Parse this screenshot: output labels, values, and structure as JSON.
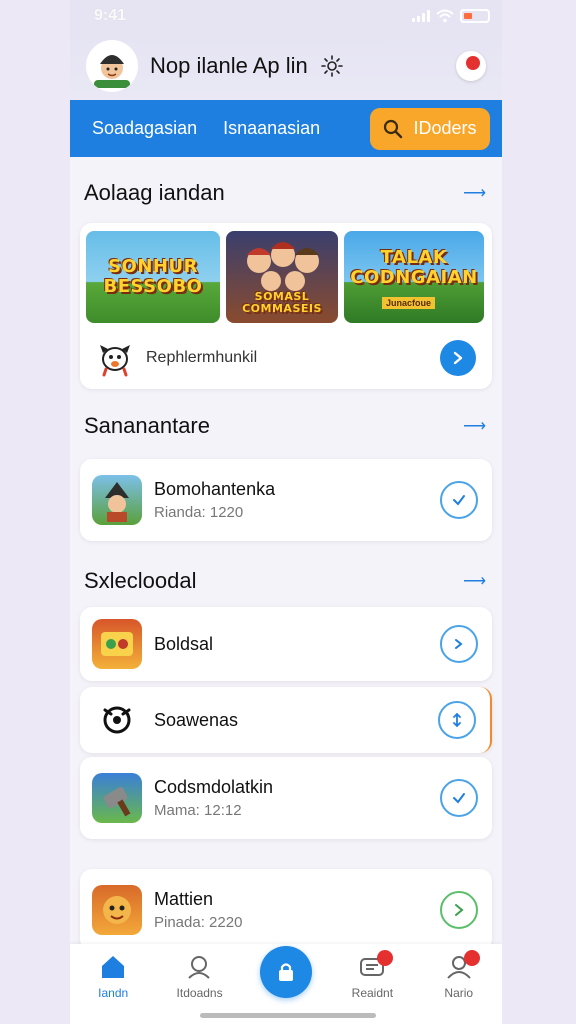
{
  "status_bar": {
    "time": "9:41"
  },
  "header": {
    "title": "Nop ilanle Ap lin"
  },
  "nav": {
    "tabs": [
      "Soadagasian",
      "Isnaanasian"
    ],
    "search_label": "IDoders"
  },
  "featured": {
    "title": "Aolaag iandan",
    "more": "⟶",
    "banners": [
      {
        "text": "SONHUR BESSOBO"
      },
      {
        "text": "SOMASL COMMASEIS"
      },
      {
        "text": "TALAK CODNGAIAN",
        "sub": "Junacfoue"
      }
    ],
    "row_label": "Rephlermhunkil"
  },
  "section2": {
    "title": "Sananantare",
    "more": "⟶",
    "items": [
      {
        "name": "Bomohantenka",
        "sub": "Rianda: 1220"
      }
    ]
  },
  "section3": {
    "title": "Sxlecloodal",
    "more": "⟶",
    "items": [
      {
        "name": "Boldsal",
        "sub": ""
      },
      {
        "name": "Soawenas",
        "sub": ""
      },
      {
        "name": "Codsmdolatkin",
        "sub": "Mama: 12:12"
      },
      {
        "name": "Mattien",
        "sub": "Pinada: 2220"
      }
    ]
  },
  "bottom_nav": {
    "tabs": [
      {
        "label": "Iandn"
      },
      {
        "label": "Itdoadns"
      },
      {
        "label": ""
      },
      {
        "label": "Reaidnt"
      },
      {
        "label": "Nario"
      }
    ]
  },
  "colors": {
    "primary": "#1e7fe0",
    "accent": "#f8a72a",
    "badge": "#e53030"
  }
}
